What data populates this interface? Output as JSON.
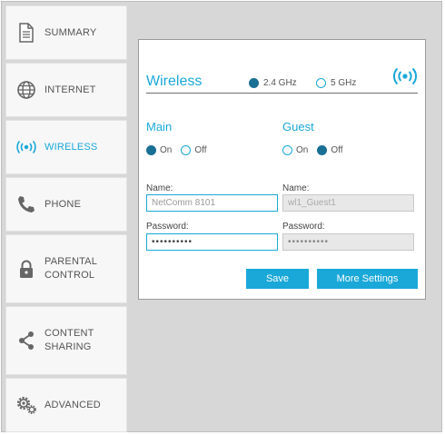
{
  "sidebar": {
    "items": [
      {
        "label": "SUMMARY",
        "icon": "document-icon"
      },
      {
        "label": "INTERNET",
        "icon": "globe-icon"
      },
      {
        "label": "WIRELESS",
        "icon": "wireless-icon",
        "active": true
      },
      {
        "label": "PHONE",
        "icon": "phone-icon"
      },
      {
        "label": "PARENTAL\nCONTROL",
        "icon": "lock-icon"
      },
      {
        "label": "CONTENT\nSHARING",
        "icon": "share-icon"
      },
      {
        "label": "ADVANCED",
        "icon": "gears-icon"
      }
    ]
  },
  "wireless": {
    "title": "Wireless",
    "band_24": "2.4 GHz",
    "band_5": "5 GHz",
    "selected_band": "2.4 GHz",
    "main": {
      "title": "Main",
      "on_label": "On",
      "off_label": "Off",
      "state": "On",
      "name_label": "Name:",
      "name_value": "NetComm 8101",
      "password_label": "Password:",
      "password_value": "••••••••••"
    },
    "guest": {
      "title": "Guest",
      "on_label": "On",
      "off_label": "Off",
      "state": "Off",
      "name_label": "Name:",
      "name_value": "wl1_Guest1",
      "password_label": "Password:",
      "password_value": "••••••••••"
    },
    "save_label": "Save",
    "more_label": "More Settings"
  },
  "colors": {
    "accent": "#1aa8d8",
    "radio_fill": "#1a6f95",
    "background": "#d7d7d7"
  }
}
